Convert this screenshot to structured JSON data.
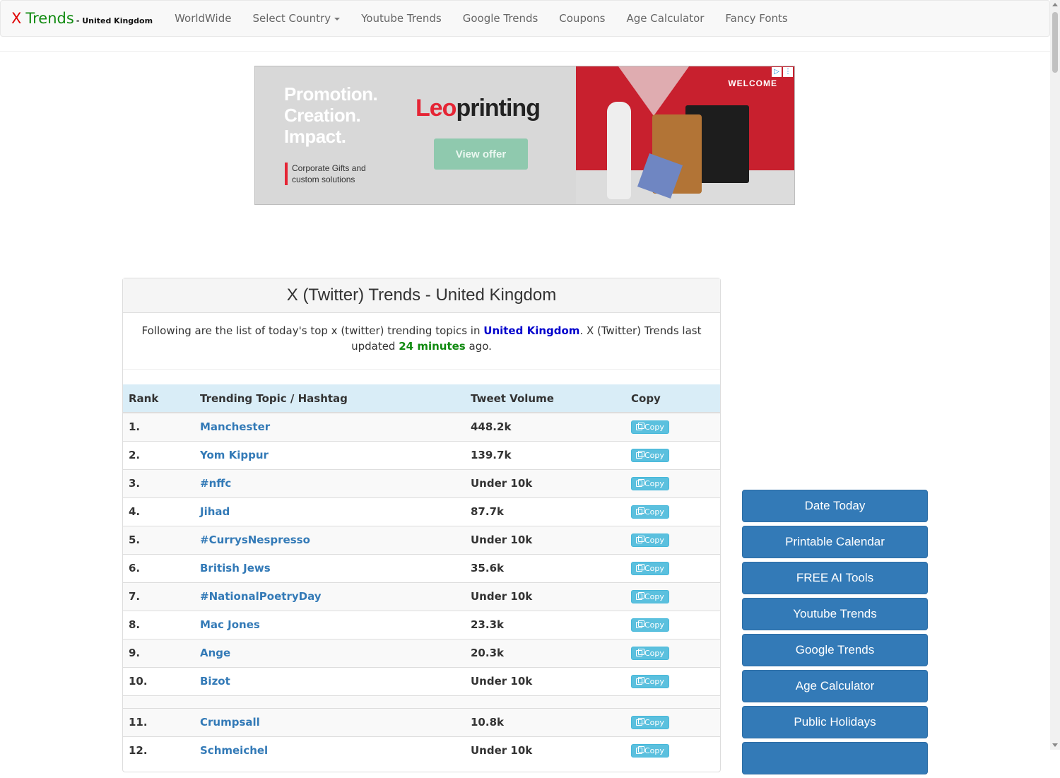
{
  "navbar": {
    "brand_x": "X",
    "brand_trends": "Trends",
    "brand_sub": "- United Kingdom",
    "items": [
      {
        "label": "WorldWide"
      },
      {
        "label": "Select Country"
      },
      {
        "label": "Youtube Trends"
      },
      {
        "label": "Google Trends"
      },
      {
        "label": "Coupons"
      },
      {
        "label": "Age Calculator"
      },
      {
        "label": "Fancy Fonts"
      }
    ]
  },
  "ad": {
    "headline_1": "Promotion.",
    "headline_2": "Creation.",
    "headline_3": "Impact.",
    "small_text": "Corporate Gifts and custom solutions",
    "brand_a": "Leo",
    "brand_b": "printing",
    "cta": "View offer",
    "welcome": "WELCOME",
    "colors": {
      "brand_red": "#e52535",
      "cta_green": "#8fc9ae"
    }
  },
  "panel": {
    "title": "X (Twitter) Trends - United Kingdom",
    "intro_a": "Following are the list of today's top x (twitter) trending topics in",
    "country": "United Kingdom",
    "intro_b": ". X (Twitter) Trends last updated",
    "ago_value": "24 minutes",
    "intro_c": "ago."
  },
  "table": {
    "headers": {
      "rank": "Rank",
      "topic": "Trending Topic / Hashtag",
      "volume": "Tweet Volume",
      "copy": "Copy"
    },
    "copy_label": "Copy",
    "rows": [
      {
        "rank": "1.",
        "topic": "Manchester",
        "volume": "448.2k"
      },
      {
        "rank": "2.",
        "topic": "Yom Kippur",
        "volume": "139.7k"
      },
      {
        "rank": "3.",
        "topic": "#nffc",
        "volume": "Under 10k"
      },
      {
        "rank": "4.",
        "topic": "Jihad",
        "volume": "87.7k"
      },
      {
        "rank": "5.",
        "topic": "#CurrysNespresso",
        "volume": "Under 10k"
      },
      {
        "rank": "6.",
        "topic": "British Jews",
        "volume": "35.6k"
      },
      {
        "rank": "7.",
        "topic": "#NationalPoetryDay",
        "volume": "Under 10k"
      },
      {
        "rank": "8.",
        "topic": "Mac Jones",
        "volume": "23.3k"
      },
      {
        "rank": "9.",
        "topic": "Ange",
        "volume": "20.3k"
      },
      {
        "rank": "10.",
        "topic": "Bizot",
        "volume": "Under 10k"
      },
      {
        "rank": "11.",
        "topic": "Crumpsall",
        "volume": "10.8k"
      },
      {
        "rank": "12.",
        "topic": "Schmeichel",
        "volume": "Under 10k"
      }
    ]
  },
  "sidebar": {
    "buttons": [
      {
        "label": "Date Today"
      },
      {
        "label": "Printable Calendar"
      },
      {
        "label": "FREE AI Tools"
      },
      {
        "label": "Youtube Trends"
      },
      {
        "label": "Google Trends"
      },
      {
        "label": "Age Calculator"
      },
      {
        "label": "Public Holidays"
      },
      {
        "label": ""
      }
    ]
  }
}
